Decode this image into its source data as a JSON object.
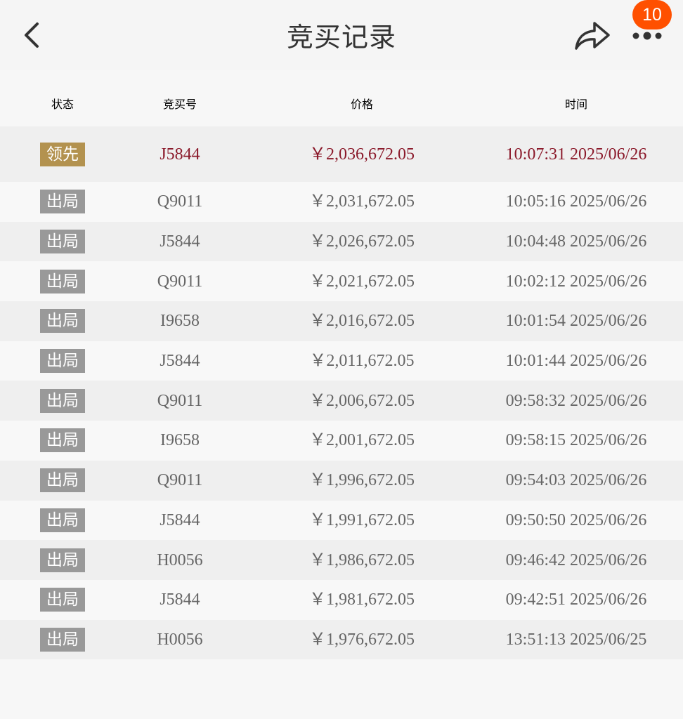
{
  "nav": {
    "title": "竞买记录",
    "badge": "10",
    "icons": {
      "back": "chevron-left-icon",
      "share": "share-arrow-icon",
      "more": "more-dots-icon"
    }
  },
  "table": {
    "headers": {
      "status": "状态",
      "bid_no": "竞买号",
      "price": "价格",
      "time": "时间"
    },
    "rows": [
      {
        "status": "领先",
        "bid_no": "J5844",
        "price": "￥2,036,672.05",
        "time": "10:07:31 2025/06/26"
      },
      {
        "status": "出局",
        "bid_no": "Q9011",
        "price": "￥2,031,672.05",
        "time": "10:05:16 2025/06/26"
      },
      {
        "status": "出局",
        "bid_no": "J5844",
        "price": "￥2,026,672.05",
        "time": "10:04:48 2025/06/26"
      },
      {
        "status": "出局",
        "bid_no": "Q9011",
        "price": "￥2,021,672.05",
        "time": "10:02:12 2025/06/26"
      },
      {
        "status": "出局",
        "bid_no": "I9658",
        "price": "￥2,016,672.05",
        "time": "10:01:54 2025/06/26"
      },
      {
        "status": "出局",
        "bid_no": "J5844",
        "price": "￥2,011,672.05",
        "time": "10:01:44 2025/06/26"
      },
      {
        "status": "出局",
        "bid_no": "Q9011",
        "price": "￥2,006,672.05",
        "time": "09:58:32 2025/06/26"
      },
      {
        "status": "出局",
        "bid_no": "I9658",
        "price": "￥2,001,672.05",
        "time": "09:58:15 2025/06/26"
      },
      {
        "status": "出局",
        "bid_no": "Q9011",
        "price": "￥1,996,672.05",
        "time": "09:54:03 2025/06/26"
      },
      {
        "status": "出局",
        "bid_no": "J5844",
        "price": "￥1,991,672.05",
        "time": "09:50:50 2025/06/26"
      },
      {
        "status": "出局",
        "bid_no": "H0056",
        "price": "￥1,986,672.05",
        "time": "09:46:42 2025/06/26"
      },
      {
        "status": "出局",
        "bid_no": "J5844",
        "price": "￥1,981,672.05",
        "time": "09:42:51 2025/06/26"
      },
      {
        "status": "出局",
        "bid_no": "H0056",
        "price": "￥1,976,672.05",
        "time": "13:51:13 2025/06/25"
      }
    ]
  },
  "colors": {
    "lead_text": "#8b1a2b",
    "lead_tag": "#b3924f",
    "out_tag": "#999999",
    "badge": "#ff5000"
  }
}
